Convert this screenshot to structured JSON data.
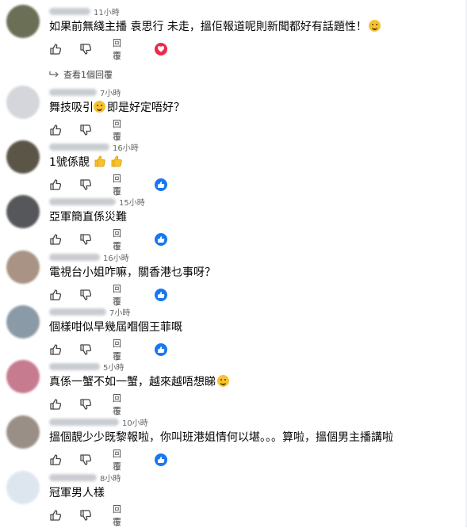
{
  "comments": [
    {
      "time": "11小時",
      "text": "如果前無綫主播 袁思行 未走，搵佢報道呢則新聞都好有話題性！",
      "emoji": "winking-face-with-tongue",
      "reply_label": "回覆",
      "reaction": "love",
      "view_replies": "查看1個回覆",
      "avatar_color": "#6b6f56"
    },
    {
      "time": "7小時",
      "text_before": "舞技吸引",
      "text_after": "即是好定唔好？",
      "emoji": "thinking-face",
      "reply_label": "回覆",
      "reaction": "",
      "avatar_color": "#d4d6dc"
    },
    {
      "time": "16小時",
      "text": "1號係靚",
      "emoji": "thumbs-up thumbs-up",
      "reply_label": "回覆",
      "reaction": "like",
      "avatar_color": "#5a5547"
    },
    {
      "time": "15小時",
      "text": "亞軍簡直係災難",
      "reply_label": "回覆",
      "reaction": "like",
      "avatar_color": "#55575a"
    },
    {
      "time": "16小時",
      "text": "電視台小姐咋嘛，關香港乜事呀？",
      "reply_label": "回覆",
      "reaction": "like",
      "avatar_color": "#a89384"
    },
    {
      "time": "7小時",
      "text": "個樣咁似早幾屆嗰個王菲嘅",
      "reply_label": "回覆",
      "reaction": "like",
      "avatar_color": "#8a9aa6"
    },
    {
      "time": "5小時",
      "text": "真係一蟹不如一蟹，越來越唔想睇",
      "emoji": "thinking-face",
      "reply_label": "回覆",
      "reaction": "",
      "avatar_color": "#c77b8f"
    },
    {
      "time": "10小時",
      "text": "搵個靚少少既黎報啦，你叫班港姐情何以堪。。。算啦，搵個男主播講啦",
      "reply_label": "回覆",
      "reaction": "like",
      "avatar_color": "#9a8f86"
    },
    {
      "time": "8小時",
      "text": "冠軍男人樣",
      "reply_label": "回覆",
      "reaction": "",
      "avatar_color": "#dde6ef"
    }
  ]
}
